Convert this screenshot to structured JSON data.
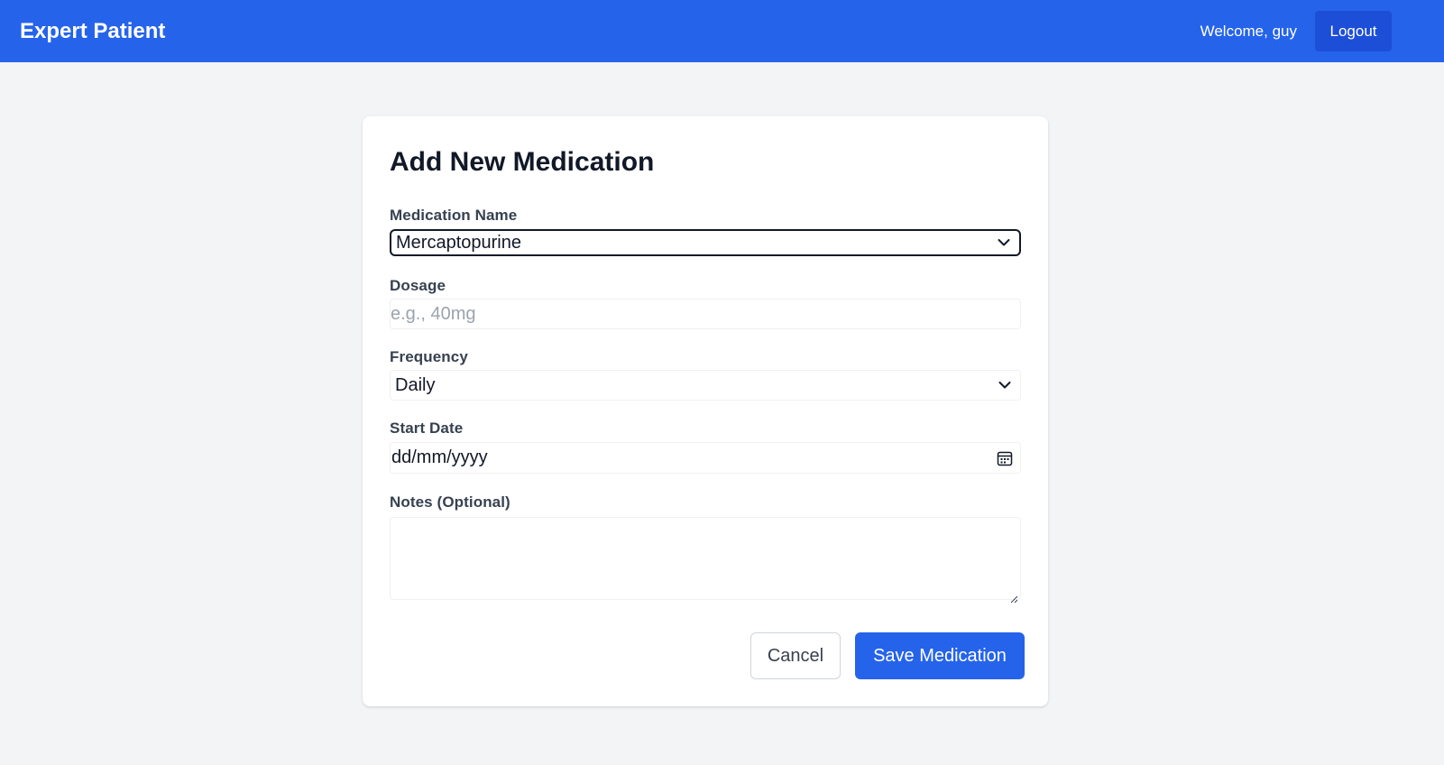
{
  "header": {
    "brand": "Expert Patient",
    "welcome": "Welcome, guy",
    "logout_label": "Logout",
    "bg_color": "#2563eb"
  },
  "form": {
    "title": "Add New Medication",
    "medication_name": {
      "label": "Medication Name",
      "value": "Mercaptopurine",
      "icon": "chevron-down-icon"
    },
    "dosage": {
      "label": "Dosage",
      "placeholder": "e.g., 40mg",
      "value": ""
    },
    "frequency": {
      "label": "Frequency",
      "value": "Daily",
      "icon": "chevron-down-icon"
    },
    "start_date": {
      "label": "Start Date",
      "value": "dd/mm/yyyy",
      "icon": "calendar-icon"
    },
    "notes": {
      "label": "Notes (Optional)",
      "value": ""
    },
    "actions": {
      "cancel_label": "Cancel",
      "save_label": "Save Medication",
      "primary_color": "#2563eb"
    }
  }
}
